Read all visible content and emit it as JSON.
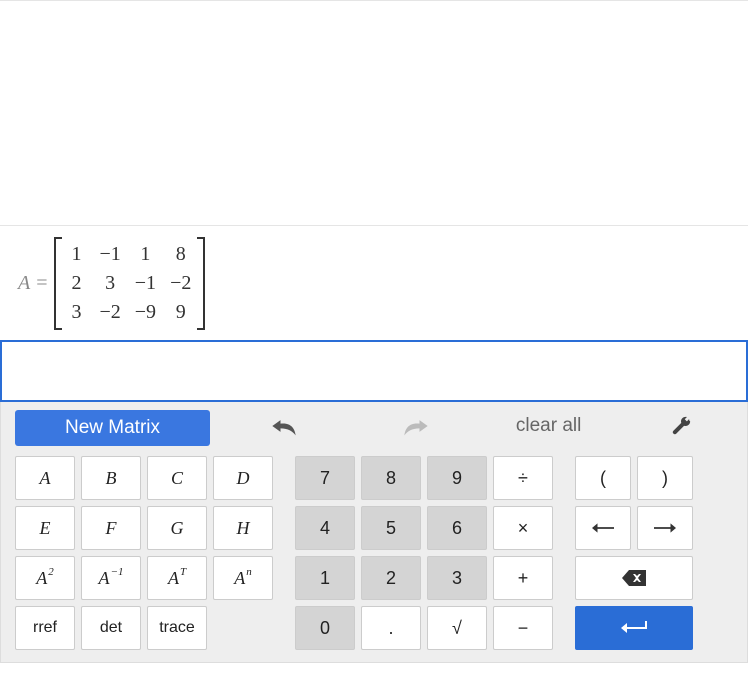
{
  "matrix": {
    "name": "A",
    "eq": "=",
    "rows": [
      [
        "1",
        "−1",
        "1",
        "8"
      ],
      [
        "2",
        "3",
        "−1",
        "−2"
      ],
      [
        "3",
        "−2",
        "−9",
        "9"
      ]
    ]
  },
  "controls": {
    "new_matrix": "New Matrix",
    "clear_all": "clear all"
  },
  "keys": {
    "letters_row1": [
      "A",
      "B",
      "C",
      "D"
    ],
    "letters_row2": [
      "E",
      "F",
      "G",
      "H"
    ],
    "power_labels": {
      "sq_base": "A",
      "sq_sup": "2",
      "inv_base": "A",
      "inv_sup": "−1",
      "t_base": "A",
      "t_sup": "T",
      "n_base": "A",
      "n_sup": "n"
    },
    "funcs": [
      "rref",
      "det",
      "trace"
    ],
    "nums": {
      "7": "7",
      "8": "8",
      "9": "9",
      "4": "4",
      "5": "5",
      "6": "6",
      "1": "1",
      "2": "2",
      "3": "3",
      "0": "0",
      "dot": ".",
      "sqrt": "√"
    },
    "ops": {
      "div": "÷",
      "mul": "×",
      "add": "+",
      "sub": "−"
    },
    "parens": {
      "l": "(",
      "r": ")"
    }
  }
}
